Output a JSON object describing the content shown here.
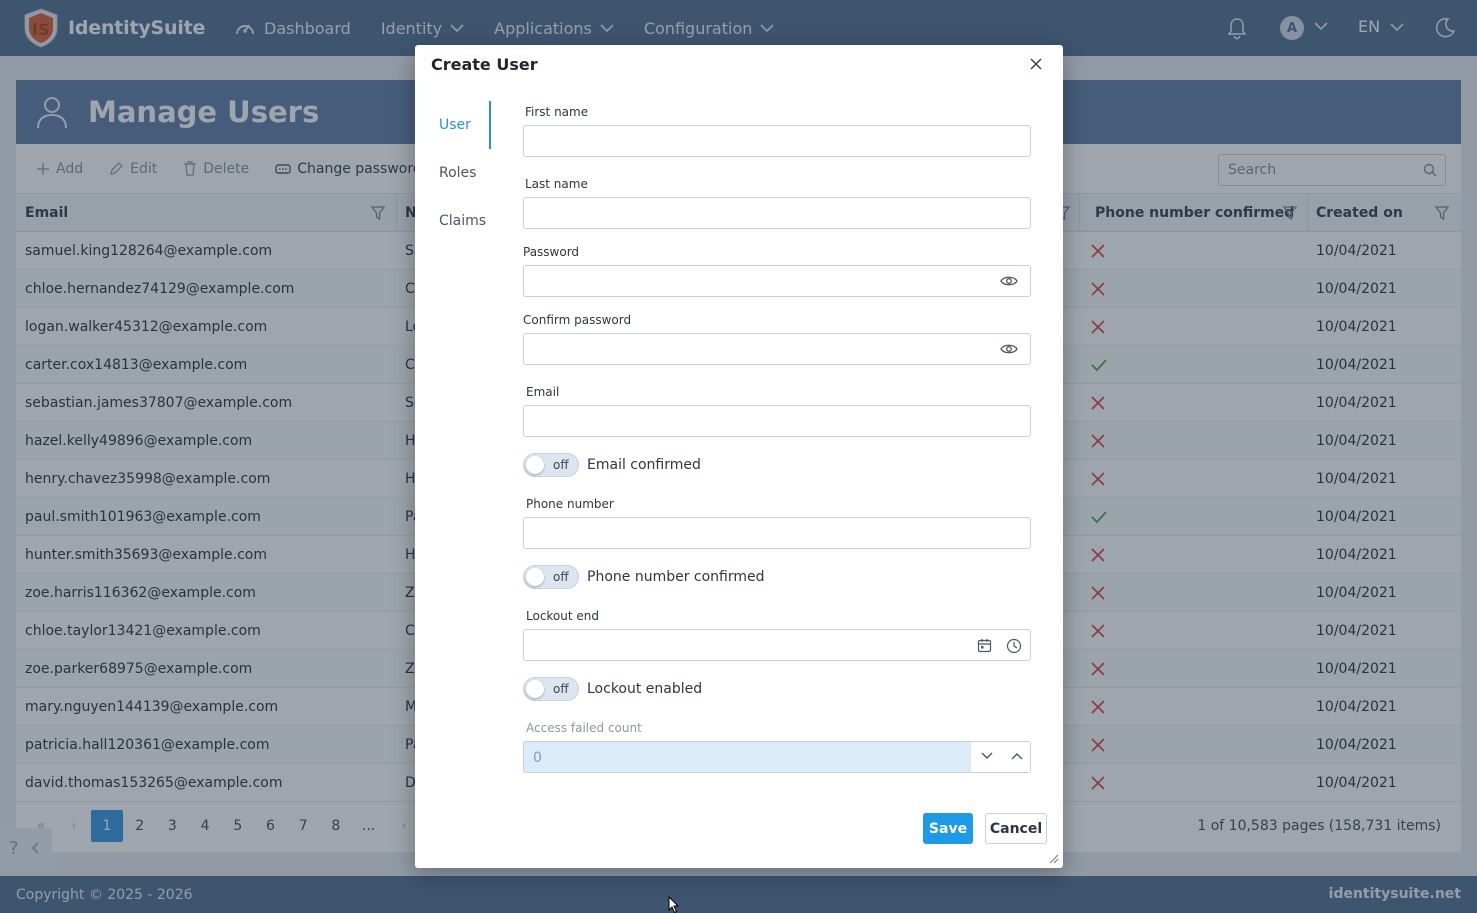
{
  "navbar": {
    "brand": "IdentitySuite",
    "items": [
      {
        "label": "Dashboard",
        "icon": "gauge-icon",
        "dropdown": false
      },
      {
        "label": "Identity",
        "dropdown": true
      },
      {
        "label": "Applications",
        "dropdown": true
      },
      {
        "label": "Configuration",
        "dropdown": true
      }
    ],
    "avatar_initial": "A",
    "language": "EN"
  },
  "page": {
    "title": "Manage Users",
    "toolbar": {
      "add": "Add",
      "edit": "Edit",
      "delete": "Delete",
      "change_password": "Change password"
    },
    "search_placeholder": "Search",
    "columns": {
      "email": "Email",
      "name": "N",
      "phone_confirmed": "Phone number confirmed",
      "created_on": "Created on"
    },
    "rows": [
      {
        "email": "samuel.king128264@example.com",
        "name": "Sa",
        "phone_confirmed": false,
        "created_on": "10/04/2021"
      },
      {
        "email": "chloe.hernandez74129@example.com",
        "name": "C",
        "phone_confirmed": false,
        "created_on": "10/04/2021"
      },
      {
        "email": "logan.walker45312@example.com",
        "name": "Lo",
        "phone_confirmed": false,
        "created_on": "10/04/2021"
      },
      {
        "email": "carter.cox14813@example.com",
        "name": "C",
        "phone_confirmed": true,
        "created_on": "10/04/2021"
      },
      {
        "email": "sebastian.james37807@example.com",
        "name": "Se",
        "phone_confirmed": false,
        "created_on": "10/04/2021"
      },
      {
        "email": "hazel.kelly49896@example.com",
        "name": "H",
        "phone_confirmed": false,
        "created_on": "10/04/2021"
      },
      {
        "email": "henry.chavez35998@example.com",
        "name": "H",
        "phone_confirmed": false,
        "created_on": "10/04/2021"
      },
      {
        "email": "paul.smith101963@example.com",
        "name": "Pa",
        "phone_confirmed": true,
        "created_on": "10/04/2021"
      },
      {
        "email": "hunter.smith35693@example.com",
        "name": "H",
        "phone_confirmed": false,
        "created_on": "10/04/2021"
      },
      {
        "email": "zoe.harris116362@example.com",
        "name": "Zo",
        "phone_confirmed": false,
        "created_on": "10/04/2021"
      },
      {
        "email": "chloe.taylor13421@example.com",
        "name": "C",
        "phone_confirmed": false,
        "created_on": "10/04/2021"
      },
      {
        "email": "zoe.parker68975@example.com",
        "name": "Zo",
        "phone_confirmed": false,
        "created_on": "10/04/2021"
      },
      {
        "email": "mary.nguyen144139@example.com",
        "name": "M",
        "phone_confirmed": false,
        "created_on": "10/04/2021"
      },
      {
        "email": "patricia.hall120361@example.com",
        "name": "Pa",
        "phone_confirmed": false,
        "created_on": "10/04/2021"
      },
      {
        "email": "david.thomas153265@example.com",
        "name": "D",
        "phone_confirmed": false,
        "created_on": "10/04/2021"
      }
    ],
    "pager": {
      "pages": [
        "1",
        "2",
        "3",
        "4",
        "5",
        "6",
        "7",
        "8",
        "..."
      ],
      "current": "1",
      "info": "1 of 10,583 pages (158,731 items)"
    },
    "help": "?"
  },
  "footer": {
    "copyright": "Copyright © 2025 - 2026",
    "site": "identitysuite.net"
  },
  "dialog": {
    "title": "Create User",
    "tabs": [
      "User",
      "Roles",
      "Claims"
    ],
    "active_tab": "User",
    "fields": {
      "first_name": "First name",
      "last_name": "Last name",
      "password": "Password",
      "confirm_password": "Confirm password",
      "email": "Email",
      "email_confirmed": "Email confirmed",
      "phone_number": "Phone number",
      "phone_number_confirmed": "Phone number confirmed",
      "lockout_end": "Lockout end",
      "lockout_enabled": "Lockout enabled",
      "access_failed_count": "Access failed count"
    },
    "switch_state": "off",
    "access_failed_count_value": "0",
    "save": "Save",
    "cancel": "Cancel"
  },
  "colors": {
    "navbar": "#5b7596",
    "header": "#6784aa",
    "primary": "#1e9be8",
    "active_tab": "#2d8fd9",
    "cross": "#d9534f",
    "check": "#4caf50"
  }
}
